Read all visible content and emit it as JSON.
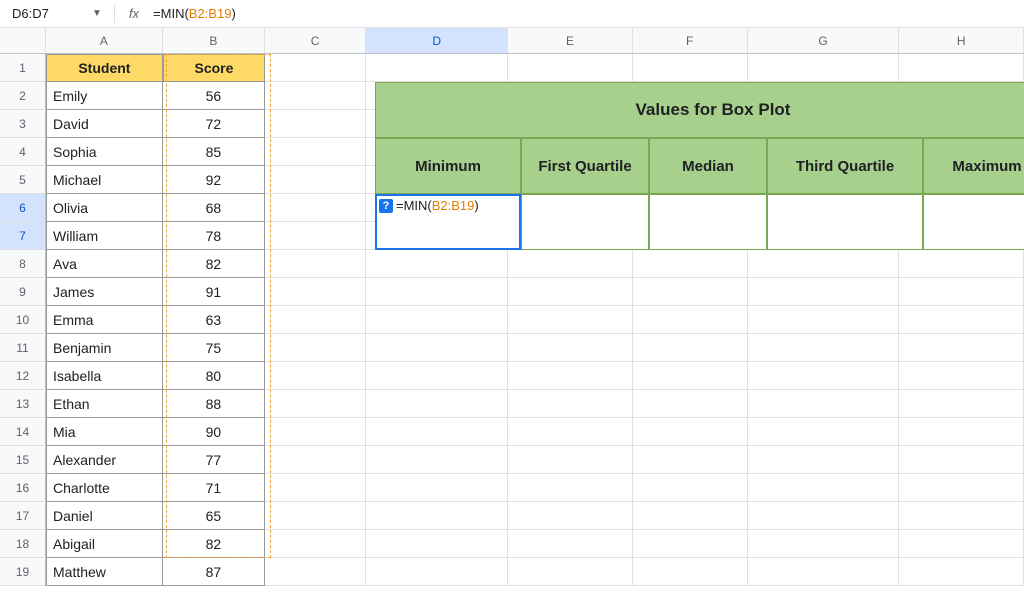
{
  "nameBox": "D6:D7",
  "fxLabel": "fx",
  "formula": {
    "prefix": "=MIN(",
    "range": "B2:B19",
    "suffix": ")"
  },
  "columns": [
    "A",
    "B",
    "C",
    "D",
    "E",
    "F",
    "G",
    "H"
  ],
  "rowCount": 19,
  "selectedCol": "D",
  "selectedRows": [
    6,
    7
  ],
  "tableHeaders": {
    "A": "Student",
    "B": "Score"
  },
  "students": [
    {
      "name": "Emily",
      "score": 56
    },
    {
      "name": "David",
      "score": 72
    },
    {
      "name": "Sophia",
      "score": 85
    },
    {
      "name": "Michael",
      "score": 92
    },
    {
      "name": "Olivia",
      "score": 68
    },
    {
      "name": "William",
      "score": 78
    },
    {
      "name": "Ava",
      "score": 82
    },
    {
      "name": "James",
      "score": 91
    },
    {
      "name": "Emma",
      "score": 63
    },
    {
      "name": "Benjamin",
      "score": 75
    },
    {
      "name": "Isabella",
      "score": 80
    },
    {
      "name": "Ethan",
      "score": 88
    },
    {
      "name": "Mia",
      "score": 90
    },
    {
      "name": "Alexander",
      "score": 77
    },
    {
      "name": "Charlotte",
      "score": 71
    },
    {
      "name": "Daniel",
      "score": 65
    },
    {
      "name": "Abigail",
      "score": 82
    },
    {
      "name": "Matthew",
      "score": 87
    }
  ],
  "boxPlot": {
    "title": "Values for Box Plot",
    "headers": [
      "Minimum",
      "First Quartile",
      "Median",
      "Third Quartile",
      "Maximum"
    ]
  },
  "helpBadge": "?"
}
